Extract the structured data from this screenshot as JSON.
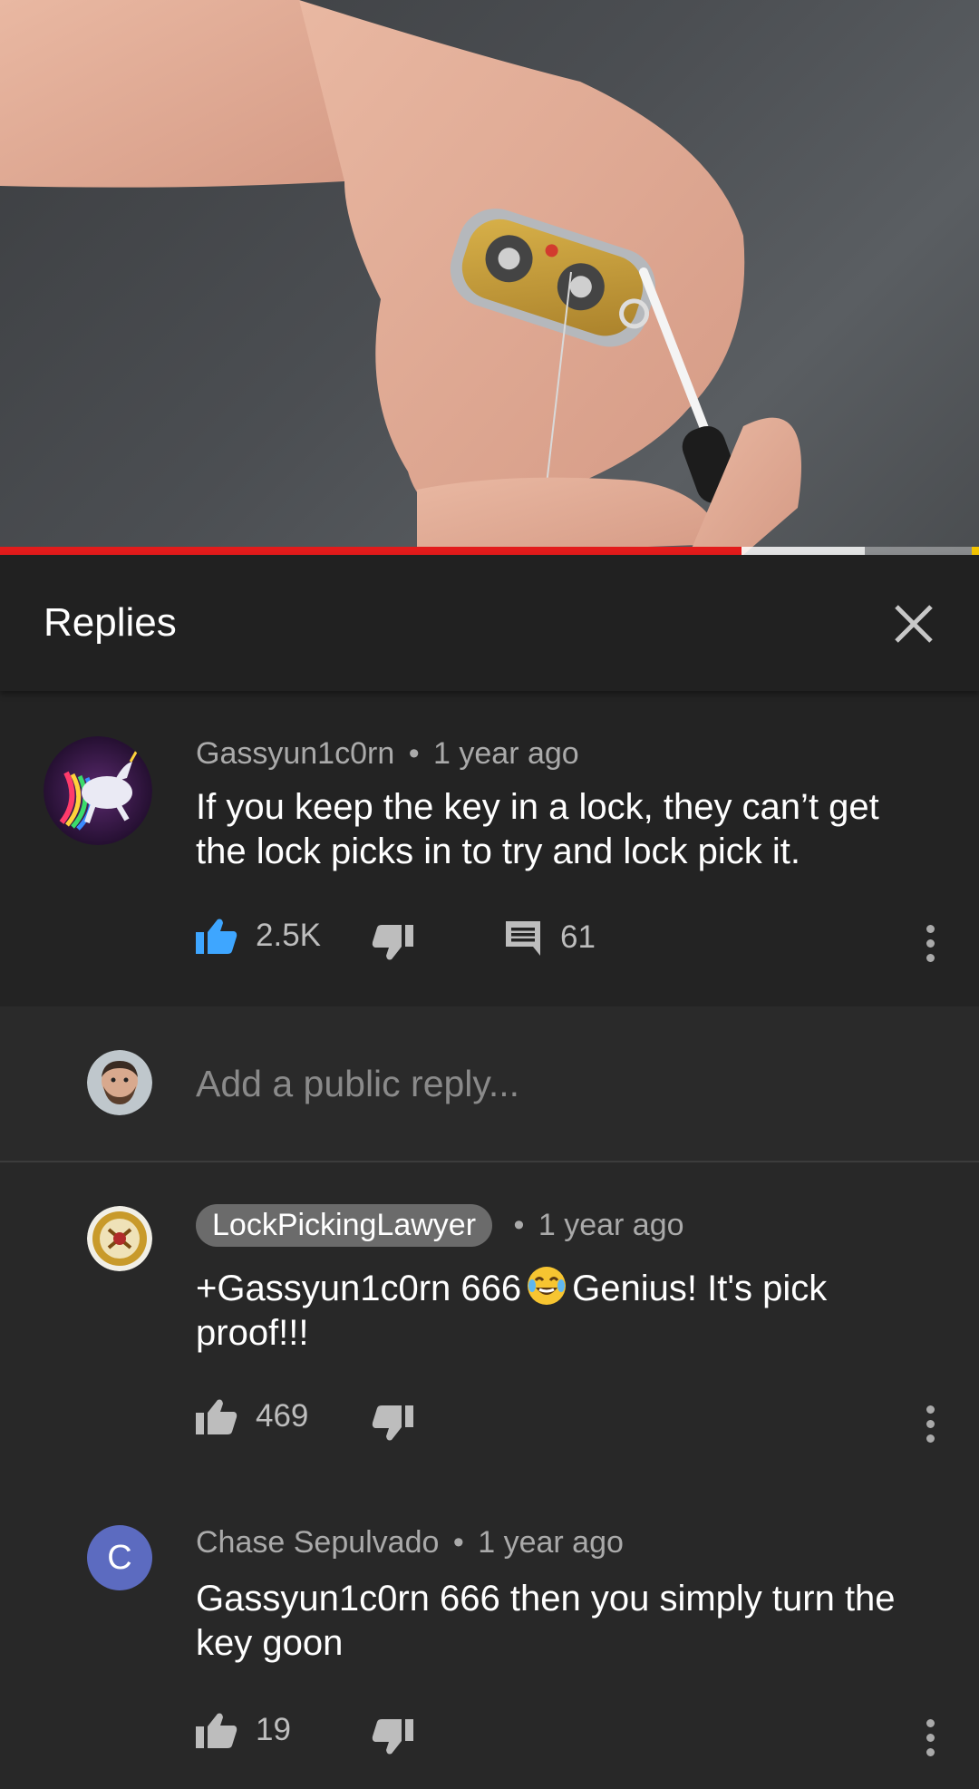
{
  "progress": {
    "played_fraction": 0.757,
    "buffered_fraction": 0.883
  },
  "replies_header": {
    "title": "Replies"
  },
  "parent_comment": {
    "author": "Gassyun1c0rn",
    "separator": "•",
    "time": "1 year ago",
    "text": "If you keep the key in a lock, they can’t get the lock picks in to try and lock pick it.",
    "likes": "2.5K",
    "replies": "61",
    "liked": true
  },
  "reply_input": {
    "placeholder": "Add a public reply..."
  },
  "replies": [
    {
      "author": "LockPickingLawyer",
      "is_creator": true,
      "separator": "•",
      "time": "1 year ago",
      "text_before_emoji": "+Gassyun1c0rn 666",
      "emoji": "face-with-tears-of-joy",
      "text_after_emoji": "Genius! It's pick proof!!!",
      "likes": "469"
    },
    {
      "author": "Chase Sepulvado",
      "avatar_letter": "C",
      "separator": "•",
      "time": "1 year ago",
      "text": "Gassyun1c0rn 666 then you simply turn the key goon",
      "likes": "19"
    }
  ],
  "colors": {
    "progress_red": "#e21b1b",
    "like_active_blue": "#3ea6ff",
    "letter_avatar": "#5c6bc0",
    "background": "#282828"
  }
}
